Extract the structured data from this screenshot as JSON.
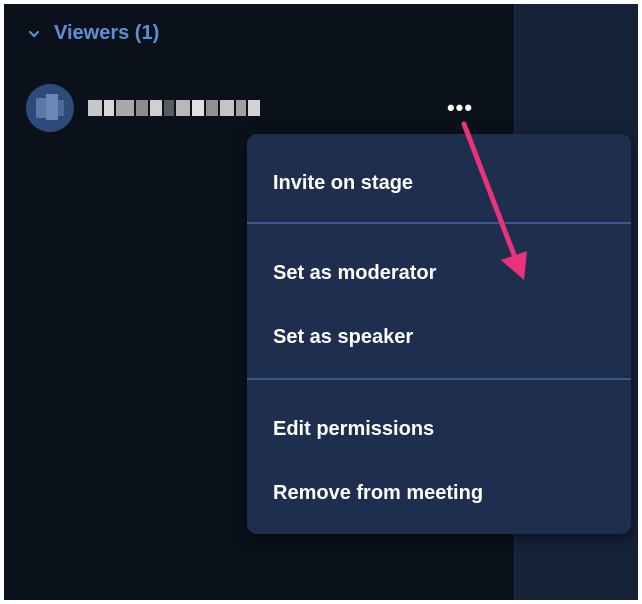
{
  "section": {
    "title": "Viewers (1)",
    "chevron_icon": "chevron-down-icon",
    "accent_color": "#5e8fd6"
  },
  "participant": {
    "avatar_icon": "avatar",
    "name_redacted": true
  },
  "more_button": {
    "label": "•••",
    "icon": "more-options-icon"
  },
  "menu": {
    "background": "#1d2e4e",
    "items": [
      {
        "label": "Invite on stage"
      },
      {
        "label": "Set as moderator"
      },
      {
        "label": "Set as speaker"
      },
      {
        "label": "Edit permissions"
      },
      {
        "label": "Remove from meeting"
      }
    ]
  },
  "annotation": {
    "icon": "arrow-annotation",
    "color": "#e8337a"
  }
}
